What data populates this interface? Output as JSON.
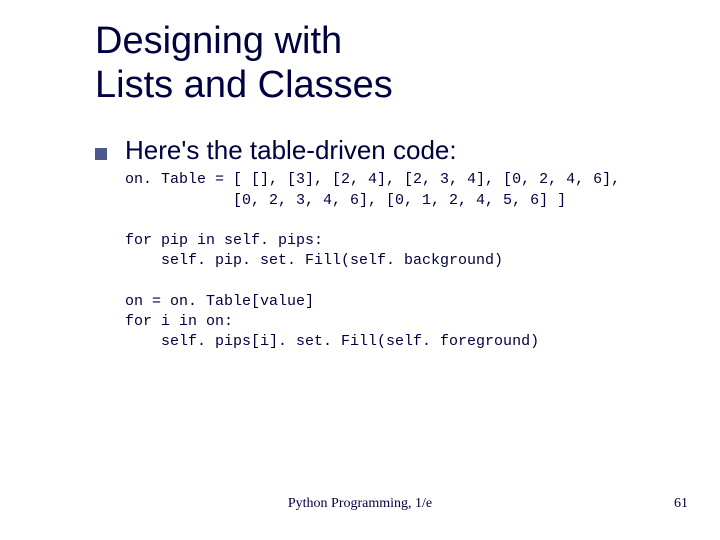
{
  "title_line1": "Designing with",
  "title_line2": "Lists and Classes",
  "bullet_text": "Here's the table-driven code:",
  "code": "on. Table = [ [], [3], [2, 4], [2, 3, 4], [0, 2, 4, 6],\n            [0, 2, 3, 4, 6], [0, 1, 2, 4, 5, 6] ]\n\nfor pip in self. pips:\n    self. pip. set. Fill(self. background)\n\non = on. Table[value]\nfor i in on:\n    self. pips[i]. set. Fill(self. foreground)",
  "footer_center": "Python Programming, 1/e",
  "footer_right": "61"
}
